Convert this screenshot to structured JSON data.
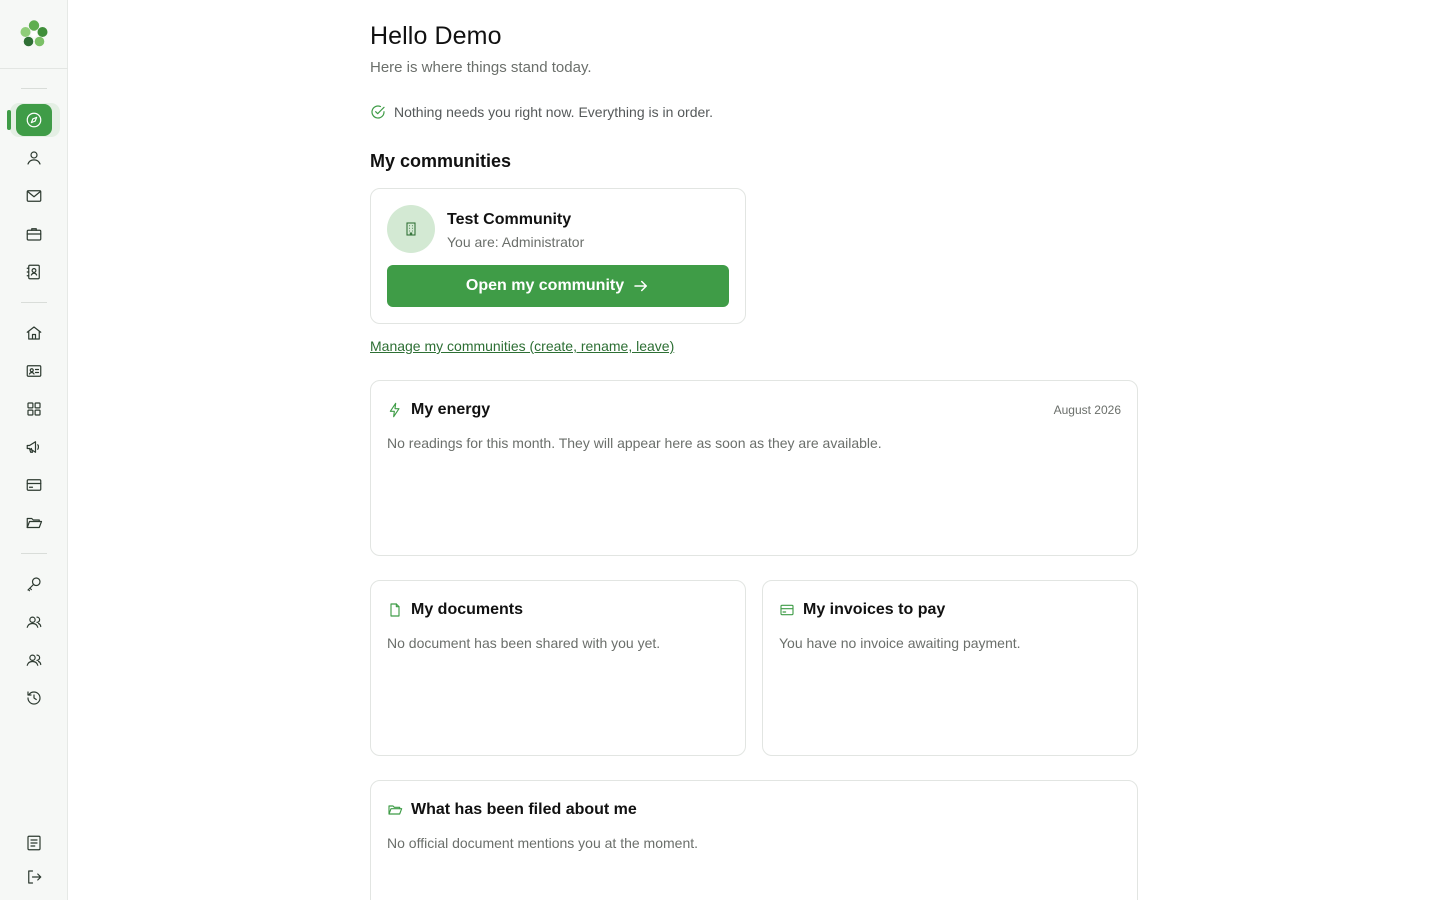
{
  "sidebar": {
    "logo_icon": "clover-logo-icon",
    "nav_top": [
      {
        "name": "dashboard",
        "icon": "compass-icon",
        "active": true
      },
      {
        "name": "profile",
        "icon": "user-icon"
      },
      {
        "name": "messages",
        "icon": "mail-icon"
      },
      {
        "name": "work",
        "icon": "briefcase-icon"
      },
      {
        "name": "contacts",
        "icon": "contact-book-icon"
      }
    ],
    "nav_middle": [
      {
        "name": "home",
        "icon": "home-icon"
      },
      {
        "name": "id-card",
        "icon": "id-card-icon"
      },
      {
        "name": "apps",
        "icon": "grid-icon"
      },
      {
        "name": "announcements",
        "icon": "megaphone-icon"
      },
      {
        "name": "payments",
        "icon": "credit-card-icon"
      },
      {
        "name": "files",
        "icon": "folder-open-icon"
      }
    ],
    "nav_bottom": [
      {
        "name": "keys",
        "icon": "key-icon"
      },
      {
        "name": "members",
        "icon": "users-icon"
      },
      {
        "name": "groups",
        "icon": "users-icon"
      },
      {
        "name": "history",
        "icon": "history-icon"
      }
    ],
    "footer": [
      {
        "name": "notes",
        "icon": "document-list-icon"
      },
      {
        "name": "logout",
        "icon": "logout-icon"
      }
    ],
    "accent": "#3f9c47"
  },
  "header": {
    "greeting": "Hello Demo",
    "subtitle": "Here is where things stand today."
  },
  "status": {
    "text": "Nothing needs you right now. Everything is in order.",
    "icon": "check-circle-icon"
  },
  "communities": {
    "title": "My communities",
    "items": [
      {
        "name": "Test Community",
        "role": "You are: Administrator",
        "icon": "building-icon",
        "open_label": "Open my community"
      }
    ],
    "manage_link": "Manage my communities (create, rename, leave)"
  },
  "energy": {
    "title": "My energy",
    "period": "August 2026",
    "body": "No readings for this month. They will appear here as soon as they are available.",
    "icon": "lightning-icon"
  },
  "documents": {
    "title": "My documents",
    "body": "No document has been shared with you yet.",
    "icon": "file-icon"
  },
  "invoices": {
    "title": "My invoices to pay",
    "body": "You have no invoice awaiting payment.",
    "icon": "credit-card-icon"
  },
  "filed": {
    "title": "What has been filed about me",
    "body": "No official document mentions you at the moment.",
    "icon": "folder-open-icon"
  }
}
